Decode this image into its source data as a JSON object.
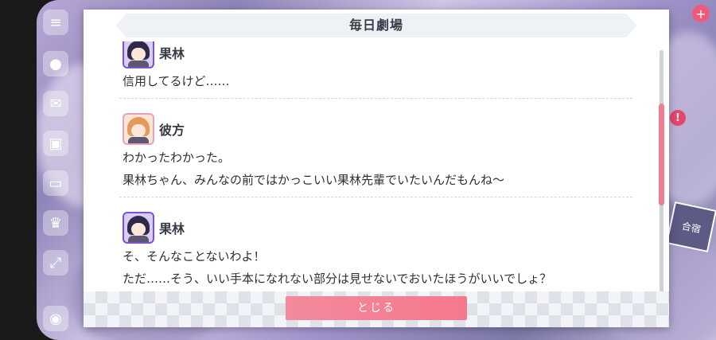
{
  "dialog": {
    "title": "毎日劇場",
    "close_label": "とじる"
  },
  "dialogue": [
    {
      "speaker": "果林",
      "avatar": "karin-portrait",
      "lines": [
        "信用してるけど……"
      ]
    },
    {
      "speaker": "彼方",
      "avatar": "kanata-portrait",
      "lines": [
        "わかったわかった。",
        "果林ちゃん、みんなの前ではかっこいい果林先輩でいたいんだもんね〜"
      ]
    },
    {
      "speaker": "果林",
      "avatar": "karin-portrait",
      "lines": [
        "そ、そんなことないわよ！",
        "ただ……そう、いい手本になれない部分は見せないでおいたほうがいいでしょ？"
      ]
    }
  ],
  "left_menu_icons": [
    "menu-icon",
    "chat-icon",
    "mail-icon",
    "gift-icon",
    "monitor-icon",
    "trophy-icon",
    "expand-icon",
    "profile-icon"
  ],
  "right_deco": {
    "plus_symbol": "+",
    "alert_symbol": "!",
    "tile_label": "合宿"
  },
  "colors": {
    "accent": "#f07c93",
    "karin_frame": "#7a54c9",
    "kanata_frame": "#e7a1c4",
    "header_band": "#eef1f5"
  }
}
